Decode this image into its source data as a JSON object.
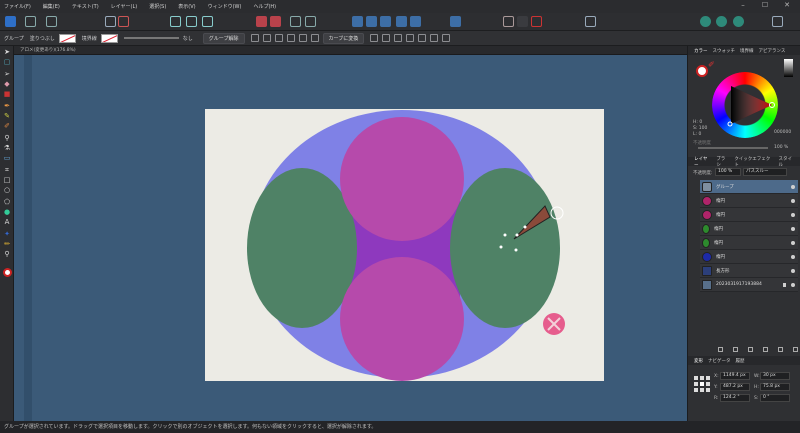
{
  "menu": [
    "ファイル(F)",
    "編集(E)",
    "テキスト(T)",
    "レイヤー(L)",
    "選択(S)",
    "表示(V)",
    "ウィンドウ(W)",
    "ヘルプ(H)"
  ],
  "context_bar": {
    "group_label": "グループ",
    "fill_label": "塗りつぶし",
    "stroke_label": "境界線",
    "stroke_none": "なし",
    "ungroup_button": "グループ解除",
    "convert_to_curves": "カーブに変換"
  },
  "document_tab": "アロメ(変更あり)(176.8%)",
  "color_panel": {
    "tabs": [
      "カラー",
      "スウォッチ",
      "境界線",
      "アピアランス"
    ],
    "h": "H: 0",
    "s": "S: 100",
    "l": "L: 0",
    "hex": "000000",
    "opacity_label": "不透明度",
    "opacity_value": "100 %"
  },
  "layers_panel": {
    "tabs": [
      "レイヤー",
      "ブラシ",
      "クイックエフェクト",
      "スタイル"
    ],
    "opacity_label": "不透明度:",
    "opacity_value": "100 %",
    "blend_mode": "パススルー",
    "layers": [
      {
        "name": "グループ",
        "color": "#7f8fa0",
        "selected": true
      },
      {
        "name": "楕円",
        "color": "#b0246a",
        "selected": false
      },
      {
        "name": "楕円",
        "color": "#b0246a",
        "selected": false
      },
      {
        "name": "楕円",
        "color": "#2d8a2d",
        "selected": false
      },
      {
        "name": "楕円",
        "color": "#2d8a2d",
        "selected": false
      },
      {
        "name": "楕円",
        "color": "#1d2aa8",
        "selected": false
      },
      {
        "name": "長方形",
        "color": "#2c3f7a",
        "selected": false
      },
      {
        "name": "20230319171938​84",
        "color": "#586f8a",
        "selected": false
      }
    ]
  },
  "transform_panel": {
    "tabs": [
      "変形",
      "ナビゲータ",
      "履歴"
    ],
    "x_label": "X:",
    "x_value": "1149.4 px",
    "y_label": "Y:",
    "y_value": "487.2 px",
    "w_label": "W:",
    "w_value": "30 px",
    "h_label": "H:",
    "h_value": "75.8 px",
    "r_label": "R:",
    "r_value": "124.2 °",
    "s_label": "S:",
    "s_value": "0 °"
  },
  "status_text": "グループが選択されています。ドラッグで選択項目を移動します。クリックで別のオブジェクトを選択します。何もない領域をクリックすると、選択が解除されます。",
  "colors": {
    "canvas_bg": "#3b5a78",
    "ellipse_blue": "#7f81e6",
    "circle_magenta": "#b64aab",
    "ellipse_green": "#4f8266",
    "center_purple": "#8e39be",
    "accent_red": "#e5447e"
  }
}
